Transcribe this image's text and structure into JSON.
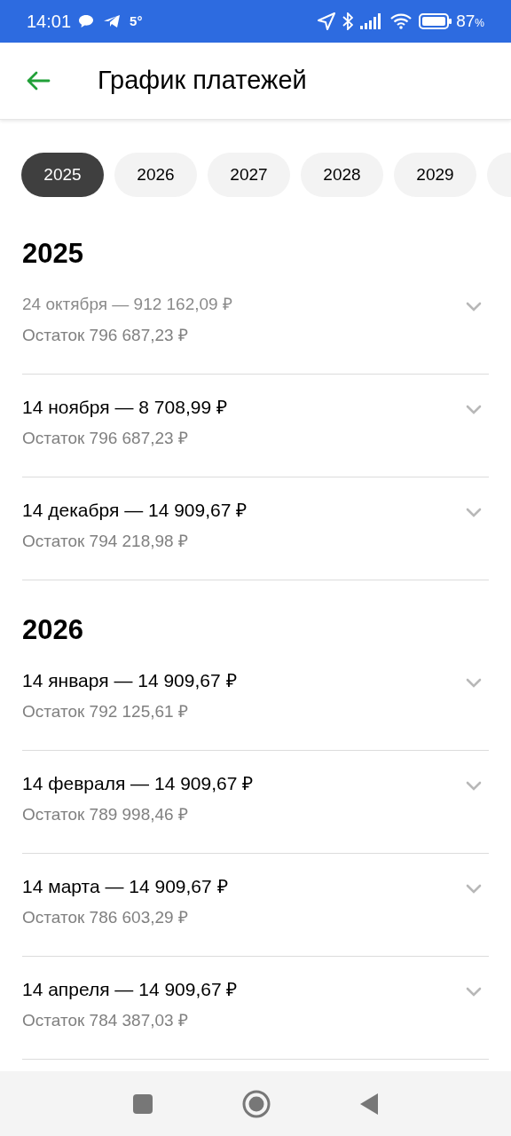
{
  "status_bar": {
    "time": "14:01",
    "temperature": "5°",
    "battery": "87",
    "battery_unit": "%"
  },
  "header": {
    "title": "График платежей"
  },
  "year_tabs": [
    {
      "label": "2025",
      "selected": true
    },
    {
      "label": "2026",
      "selected": false
    },
    {
      "label": "2027",
      "selected": false
    },
    {
      "label": "2028",
      "selected": false
    },
    {
      "label": "2029",
      "selected": false
    },
    {
      "selected": false
    }
  ],
  "sections": [
    {
      "year": "2025",
      "payments": [
        {
          "title": "24 октября — 912 162,09 ₽",
          "balance": "Остаток 796 687,23 ₽",
          "paid": true
        },
        {
          "title": "14 ноября — 8 708,99 ₽",
          "balance": "Остаток 796 687,23 ₽",
          "paid": false
        },
        {
          "title": "14 декабря — 14 909,67 ₽",
          "balance": "Остаток 794 218,98 ₽",
          "paid": false
        }
      ]
    },
    {
      "year": "2026",
      "payments": [
        {
          "title": "14 января — 14 909,67 ₽",
          "balance": "Остаток 792 125,61 ₽",
          "paid": false
        },
        {
          "title": "14 февраля — 14 909,67 ₽",
          "balance": "Остаток 789 998,46 ₽",
          "paid": false
        },
        {
          "title": "14 марта — 14 909,67 ₽",
          "balance": "Остаток 786 603,29 ₽",
          "paid": false
        },
        {
          "title": "14 апреля — 14 909,67 ₽",
          "balance": "Остаток 784 387,03 ₽",
          "paid": false
        }
      ]
    }
  ]
}
